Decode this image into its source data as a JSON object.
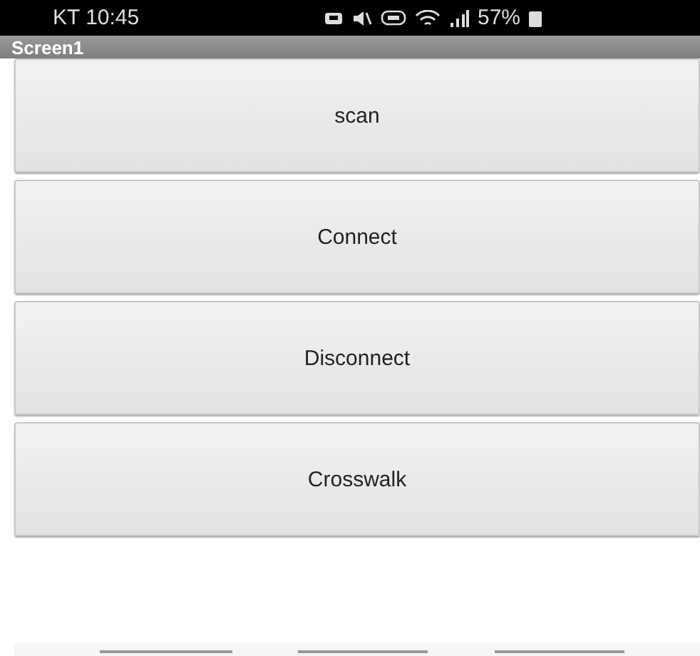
{
  "status_bar": {
    "carrier_time": "KT 10:45",
    "battery": "57%"
  },
  "title_bar": {
    "title": "Screen1"
  },
  "buttons": [
    {
      "label": "scan"
    },
    {
      "label": "Connect"
    },
    {
      "label": "Disconnect"
    },
    {
      "label": "Crosswalk"
    }
  ]
}
